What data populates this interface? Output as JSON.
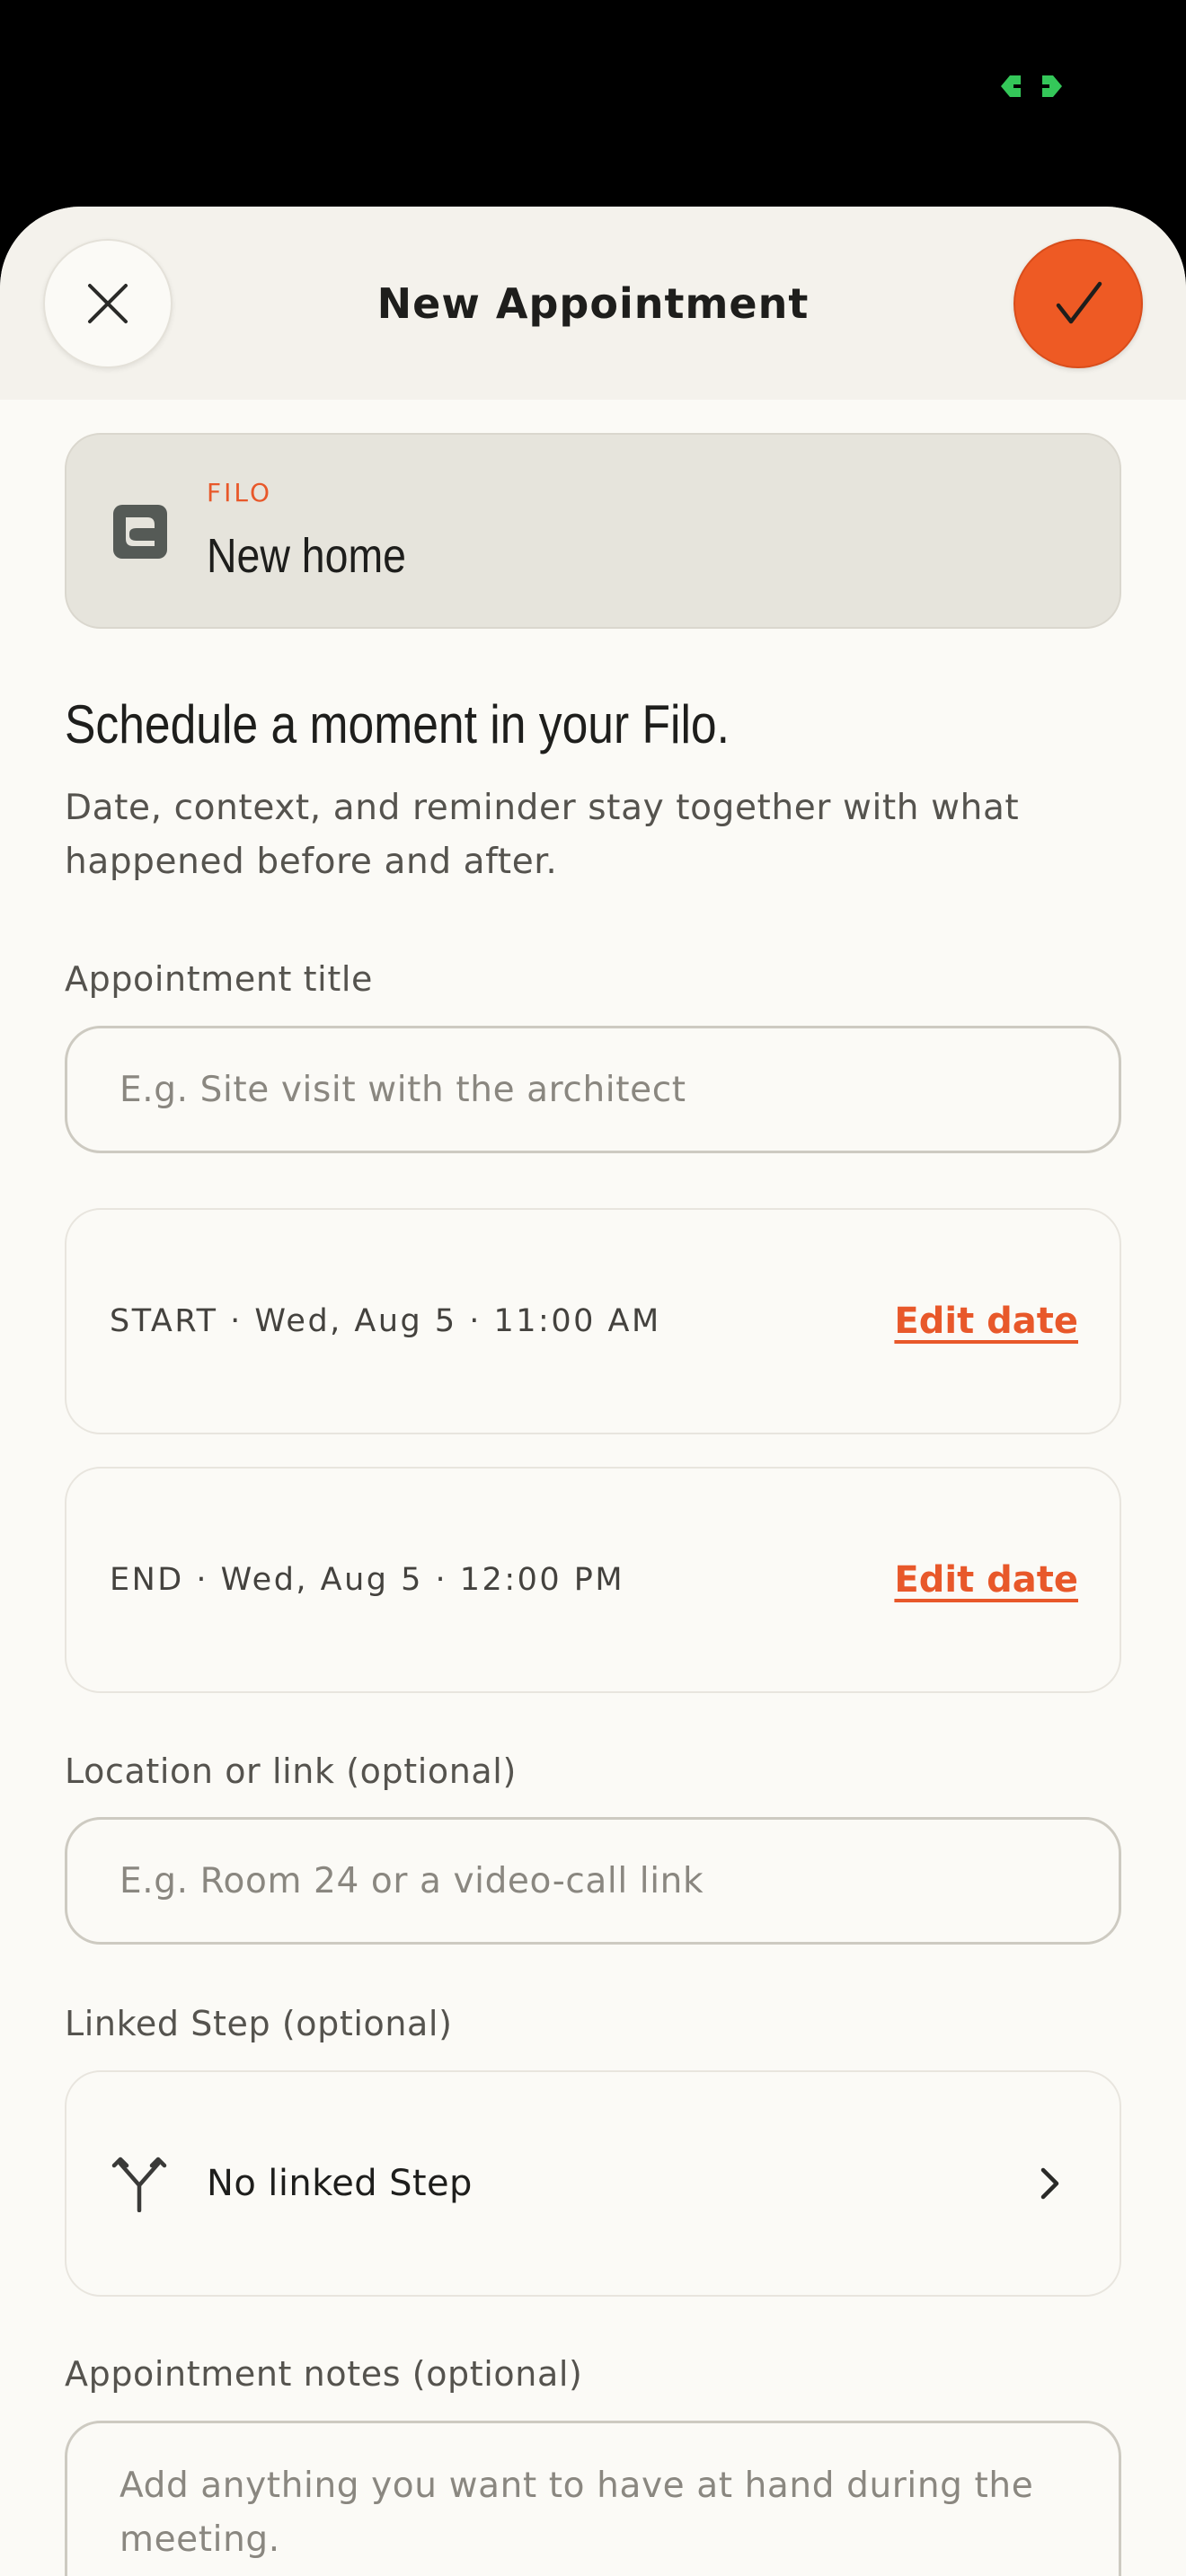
{
  "colors": {
    "accent": "#EE5A24",
    "accent_text": "#E8582A",
    "background": "#FBFAF6",
    "header_background": "#F4F2EC",
    "card_background": "#E6E4DC",
    "text_primary": "#1E1E1C",
    "text_secondary": "#55534E",
    "camera_indicator": "#34C759"
  },
  "header": {
    "title": "New Appointment",
    "close_icon": "close-icon",
    "confirm_icon": "checkmark-icon"
  },
  "filo": {
    "kicker": "FILO",
    "name": "New home",
    "icon": "filo-logo-icon"
  },
  "intro": {
    "heading": "Schedule a moment in your Filo.",
    "text": "Date, context, and reminder stay together with what happened before and after."
  },
  "form": {
    "title": {
      "label": "Appointment title",
      "value": "",
      "placeholder": "E.g. Site visit with the architect"
    },
    "start": {
      "text": "START · Wed, Aug 5 · 11:00 AM",
      "edit_label": "Edit date"
    },
    "end": {
      "text": "END · Wed, Aug 5 · 12:00 PM",
      "edit_label": "Edit date"
    },
    "location": {
      "label": "Location or link (optional)",
      "value": "",
      "placeholder": "E.g. Room 24 or a video-call link"
    },
    "linked_step": {
      "label": "Linked Step (optional)",
      "value": "No linked Step",
      "icon": "branch-icon",
      "chevron": "chevron-right-icon"
    },
    "notes": {
      "label": "Appointment notes (optional)",
      "value": "",
      "placeholder": "Add anything you want to have at hand during the meeting."
    }
  }
}
